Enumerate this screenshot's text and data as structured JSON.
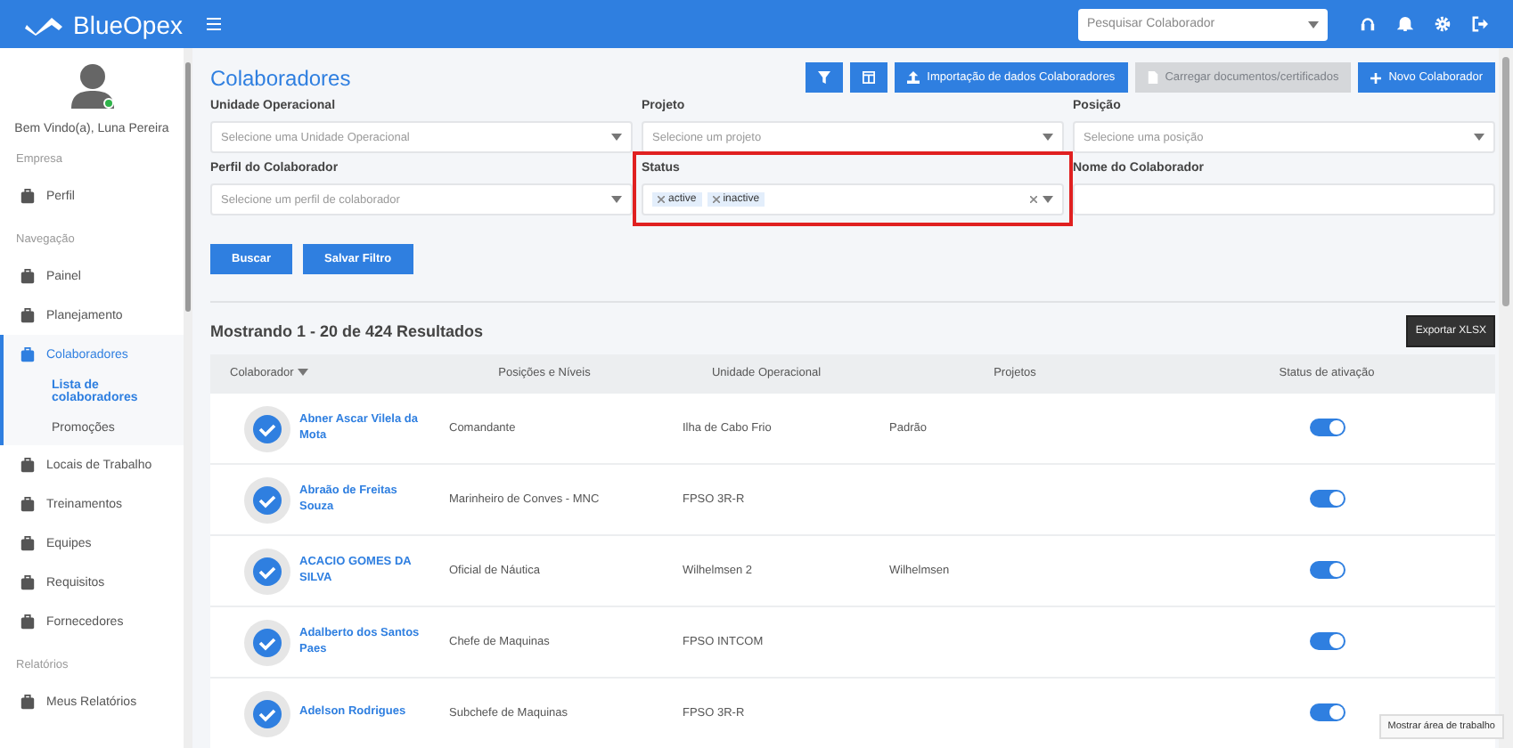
{
  "header": {
    "brand": "BlueOpex",
    "search": {
      "placeholder": "Pesquisar Colaborador"
    }
  },
  "sidebar": {
    "user": "Bem Vindo(a), Luna Pereira",
    "online": true,
    "sections": [
      {
        "title": "Empresa",
        "items": [
          {
            "label": "Perfil",
            "selected": false
          }
        ]
      },
      {
        "title": "Navegação",
        "items": [
          {
            "label": "Painel",
            "selected": false
          },
          {
            "label": "Planejamento",
            "selected": false
          },
          {
            "label": "Colaboradores",
            "selected": true,
            "expanded": true,
            "children": [
              {
                "label": "Lista de colaboradores",
                "selected": true
              },
              {
                "label": "Promoções",
                "selected": false
              }
            ]
          },
          {
            "label": "Locais de Trabalho",
            "selected": false
          },
          {
            "label": "Treinamentos",
            "selected": false
          },
          {
            "label": "Equipes",
            "selected": false
          },
          {
            "label": "Requisitos",
            "selected": false
          },
          {
            "label": "Fornecedores",
            "selected": false
          }
        ]
      },
      {
        "title": "Relatórios",
        "items": [
          {
            "label": "Meus Relatórios",
            "selected": false
          }
        ]
      }
    ]
  },
  "page": {
    "title": "Colaboradores",
    "toolbar": [
      {
        "kind": "icon",
        "disabled": false
      },
      {
        "kind": "icon",
        "disabled": false
      },
      {
        "kind": "upload",
        "label": "Importação de dados Colaboradores",
        "disabled": false
      },
      {
        "kind": "file",
        "label": "Carregar documentos/certificados",
        "disabled": true
      },
      {
        "kind": "plus",
        "label": "Novo Colaborador",
        "disabled": false
      }
    ],
    "filters": [
      {
        "label": "Unidade Operacional",
        "kind": "select",
        "placeholder": "Selecione uma Unidade Operacional",
        "highlighted": false
      },
      {
        "label": "Projeto",
        "kind": "select",
        "placeholder": "Selecione um projeto",
        "highlighted": false
      },
      {
        "label": "Posição",
        "kind": "select",
        "placeholder": "Selecione uma posição",
        "highlighted": false
      },
      {
        "label": "Perfil do Colaborador",
        "kind": "select",
        "placeholder": "Selecione um perfil de colaborador",
        "highlighted": false
      },
      {
        "label": "Status",
        "kind": "tags",
        "tags": [
          "active",
          "inactive"
        ],
        "highlighted": true
      },
      {
        "label": "Nome do Colaborador",
        "kind": "text",
        "highlighted": false
      }
    ],
    "actions": [
      "Buscar",
      "Salvar Filtro"
    ],
    "results": "Mostrando 1 - 20 de 424 Resultados",
    "export": "Exportar XLSX"
  },
  "table": {
    "columns": [
      "Colaborador",
      "Posições e Níveis",
      "Unidade Operacional",
      "Projetos",
      "Status de ativação"
    ],
    "rows": [
      {
        "name": "Abner Ascar Vilela da Mota",
        "position": "Comandante",
        "unit": "Ilha de Cabo Frio",
        "project": "Padrão",
        "on": true
      },
      {
        "name": "Abraão de Freitas Souza",
        "position": "Marinheiro de Conves - MNC",
        "unit": "FPSO 3R-R",
        "on": true
      },
      {
        "name": "ACACIO GOMES DA SILVA",
        "position": "Oficial de Náutica",
        "unit": "Wilhelmsen 2",
        "project": "Wilhelmsen",
        "on": true
      },
      {
        "name": "Adalberto dos Santos Paes",
        "position": "Chefe de Maquinas",
        "unit": "FPSO INTCOM",
        "on": true
      },
      {
        "name": "Adelson Rodrigues",
        "position": "Subchefe de Maquinas",
        "unit": "FPSO 3R-R",
        "on": true
      }
    ]
  },
  "tooltip": "Mostrar área de trabalho"
}
